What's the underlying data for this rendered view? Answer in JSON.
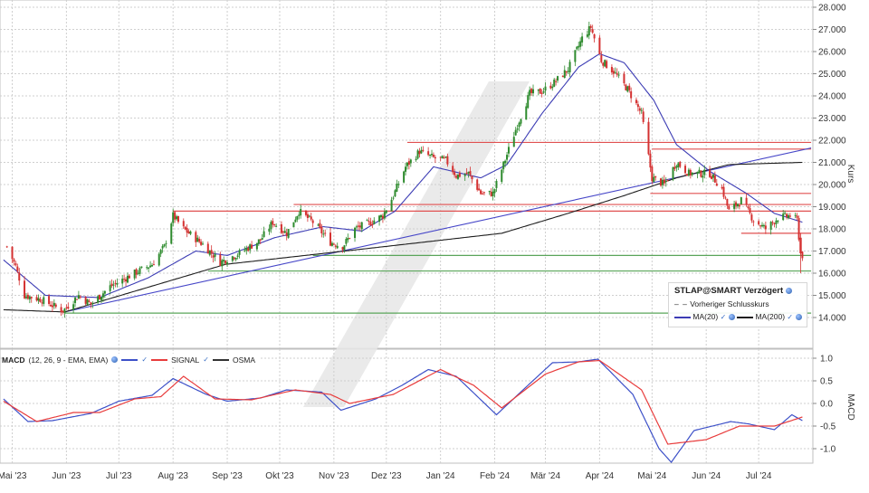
{
  "chart_data": [
    {
      "type": "candlestick",
      "title": "STLAP@SMART Verzögert",
      "ylabel": "Kurs",
      "ylim": [
        13.0,
        28.0
      ],
      "y_ticks": [
        "14.000",
        "15.000",
        "16.000",
        "17.000",
        "18.000",
        "19.000",
        "20.000",
        "21.000",
        "22.000",
        "23.000",
        "24.000",
        "25.000",
        "26.000",
        "27.000",
        "28.000"
      ],
      "x_ticks": [
        "Mai '23",
        "Jun '23",
        "Jul '23",
        "Aug '23",
        "Sep '23",
        "Okt '23",
        "Nov '23",
        "Dez '23",
        "Jan '24",
        "Feb '24",
        "Mär '24",
        "Apr '24",
        "Mai '24",
        "Jun '24",
        "Jul '24"
      ],
      "close_anchors": [
        {
          "date": "2023-04-28",
          "value": 17.2
        },
        {
          "date": "2023-05-03",
          "value": 16.3
        },
        {
          "date": "2023-05-08",
          "value": 15.0
        },
        {
          "date": "2023-05-18",
          "value": 14.8
        },
        {
          "date": "2023-05-30",
          "value": 14.3
        },
        {
          "date": "2023-06-08",
          "value": 15.0
        },
        {
          "date": "2023-06-15",
          "value": 14.6
        },
        {
          "date": "2023-06-26",
          "value": 15.4
        },
        {
          "date": "2023-07-10",
          "value": 16.0
        },
        {
          "date": "2023-07-20",
          "value": 16.4
        },
        {
          "date": "2023-07-27",
          "value": 17.2
        },
        {
          "date": "2023-08-01",
          "value": 18.6
        },
        {
          "date": "2023-08-07",
          "value": 18.0
        },
        {
          "date": "2023-08-18",
          "value": 17.3
        },
        {
          "date": "2023-08-28",
          "value": 16.5
        },
        {
          "date": "2023-09-08",
          "value": 16.9
        },
        {
          "date": "2023-09-20",
          "value": 17.5
        },
        {
          "date": "2023-09-27",
          "value": 18.3
        },
        {
          "date": "2023-10-05",
          "value": 17.8
        },
        {
          "date": "2023-10-12",
          "value": 18.8
        },
        {
          "date": "2023-10-20",
          "value": 18.3
        },
        {
          "date": "2023-10-30",
          "value": 17.4
        },
        {
          "date": "2023-11-06",
          "value": 17.2
        },
        {
          "date": "2023-11-13",
          "value": 18.0
        },
        {
          "date": "2023-11-22",
          "value": 18.3
        },
        {
          "date": "2023-11-29",
          "value": 18.6
        },
        {
          "date": "2023-12-05",
          "value": 19.5
        },
        {
          "date": "2023-12-12",
          "value": 20.8
        },
        {
          "date": "2023-12-20",
          "value": 21.5
        },
        {
          "date": "2023-12-28",
          "value": 21.2
        },
        {
          "date": "2024-01-04",
          "value": 21.1
        },
        {
          "date": "2024-01-10",
          "value": 20.4
        },
        {
          "date": "2024-01-17",
          "value": 20.5
        },
        {
          "date": "2024-01-24",
          "value": 19.6
        },
        {
          "date": "2024-01-31",
          "value": 19.6
        },
        {
          "date": "2024-02-06",
          "value": 20.9
        },
        {
          "date": "2024-02-14",
          "value": 22.7
        },
        {
          "date": "2024-02-21",
          "value": 24.1
        },
        {
          "date": "2024-02-28",
          "value": 24.2
        },
        {
          "date": "2024-03-06",
          "value": 24.6
        },
        {
          "date": "2024-03-14",
          "value": 25.2
        },
        {
          "date": "2024-03-22",
          "value": 26.6
        },
        {
          "date": "2024-03-27",
          "value": 27.1
        },
        {
          "date": "2024-04-02",
          "value": 25.6
        },
        {
          "date": "2024-04-09",
          "value": 25.1
        },
        {
          "date": "2024-04-17",
          "value": 24.3
        },
        {
          "date": "2024-04-25",
          "value": 23.2
        },
        {
          "date": "2024-05-01",
          "value": 20.3
        },
        {
          "date": "2024-05-08",
          "value": 20.0
        },
        {
          "date": "2024-05-15",
          "value": 21.0
        },
        {
          "date": "2024-05-22",
          "value": 20.5
        },
        {
          "date": "2024-06-03",
          "value": 20.5
        },
        {
          "date": "2024-06-10",
          "value": 19.8
        },
        {
          "date": "2024-06-14",
          "value": 18.8
        },
        {
          "date": "2024-06-21",
          "value": 19.3
        },
        {
          "date": "2024-06-28",
          "value": 18.4
        },
        {
          "date": "2024-07-05",
          "value": 18.0
        },
        {
          "date": "2024-07-12",
          "value": 18.5
        },
        {
          "date": "2024-07-19",
          "value": 18.6
        },
        {
          "date": "2024-07-23",
          "value": 18.4
        },
        {
          "date": "2024-07-25",
          "value": 16.9
        },
        {
          "date": "2024-07-26",
          "value": 16.8
        }
      ],
      "indicators": {
        "ma20_anchors": [
          {
            "date": "2023-04-26",
            "value": 16.6
          },
          {
            "date": "2023-05-20",
            "value": 15.0
          },
          {
            "date": "2023-06-20",
            "value": 14.9
          },
          {
            "date": "2023-07-18",
            "value": 15.8
          },
          {
            "date": "2023-08-14",
            "value": 17.0
          },
          {
            "date": "2023-09-01",
            "value": 16.8
          },
          {
            "date": "2023-09-28",
            "value": 17.6
          },
          {
            "date": "2023-10-26",
            "value": 18.1
          },
          {
            "date": "2023-11-17",
            "value": 17.9
          },
          {
            "date": "2023-12-06",
            "value": 18.8
          },
          {
            "date": "2023-12-28",
            "value": 20.8
          },
          {
            "date": "2024-01-24",
            "value": 20.3
          },
          {
            "date": "2024-02-08",
            "value": 20.9
          },
          {
            "date": "2024-02-28",
            "value": 23.2
          },
          {
            "date": "2024-03-20",
            "value": 25.3
          },
          {
            "date": "2024-04-01",
            "value": 25.9
          },
          {
            "date": "2024-04-15",
            "value": 25.5
          },
          {
            "date": "2024-05-02",
            "value": 23.8
          },
          {
            "date": "2024-05-15",
            "value": 21.8
          },
          {
            "date": "2024-06-03",
            "value": 20.6
          },
          {
            "date": "2024-06-24",
            "value": 19.6
          },
          {
            "date": "2024-07-10",
            "value": 18.7
          },
          {
            "date": "2024-07-26",
            "value": 18.3
          }
        ],
        "ma200_anchors": [
          {
            "date": "2023-04-26",
            "value": 14.35
          },
          {
            "date": "2023-05-31",
            "value": 14.25
          },
          {
            "date": "2023-08-31",
            "value": 16.4
          },
          {
            "date": "2023-11-30",
            "value": 17.2
          },
          {
            "date": "2024-02-05",
            "value": 17.8
          },
          {
            "date": "2024-03-14",
            "value": 18.7
          },
          {
            "date": "2024-04-15",
            "value": 19.5
          },
          {
            "date": "2024-05-15",
            "value": 20.3
          },
          {
            "date": "2024-06-14",
            "value": 20.9
          },
          {
            "date": "2024-07-26",
            "value": 21.0
          }
        ],
        "trendline": {
          "from": {
            "date": "2023-05-31",
            "value": 14.25
          },
          "to": {
            "date": "2024-07-31",
            "value": 21.65
          }
        }
      },
      "hlines": [
        {
          "value": 21.9,
          "from": "2023-12-13",
          "to": "2024-07-31",
          "color": "#e05050"
        },
        {
          "value": 21.6,
          "from": "2024-05-01",
          "to": "2024-07-31",
          "color": "#e05050"
        },
        {
          "value": 19.6,
          "from": "2024-04-30",
          "to": "2024-07-31",
          "color": "#e05050"
        },
        {
          "value": 19.1,
          "from": "2023-10-09",
          "to": "2024-07-31",
          "color": "#e05050"
        },
        {
          "value": 18.8,
          "from": "2023-08-01",
          "to": "2024-07-31",
          "color": "#e05050"
        },
        {
          "value": 17.8,
          "from": "2024-06-21",
          "to": "2024-07-31",
          "color": "#e05050"
        },
        {
          "value": 16.8,
          "from": "2023-10-20",
          "to": "2024-07-31",
          "color": "#5aa55a"
        },
        {
          "value": 16.1,
          "from": "2023-08-21",
          "to": "2024-07-31",
          "color": "#5aa55a"
        },
        {
          "value": 14.2,
          "from": "2023-05-31",
          "to": "2024-07-31",
          "color": "#5aa55a"
        }
      ]
    },
    {
      "type": "line",
      "ylabel": "MACD",
      "ylim": [
        -1.35,
        1.15
      ],
      "y_ticks": [
        "1.0",
        "0.5",
        "0.0",
        "-0.5",
        "-1.0"
      ],
      "series": [
        {
          "name": "MACD",
          "anchors": [
            {
              "date": "2023-04-26",
              "value": 0.1
            },
            {
              "date": "2023-05-10",
              "value": -0.4
            },
            {
              "date": "2023-05-24",
              "value": -0.38
            },
            {
              "date": "2023-06-15",
              "value": -0.22
            },
            {
              "date": "2023-07-01",
              "value": 0.05
            },
            {
              "date": "2023-07-20",
              "value": 0.18
            },
            {
              "date": "2023-08-01",
              "value": 0.55
            },
            {
              "date": "2023-08-20",
              "value": 0.2
            },
            {
              "date": "2023-09-01",
              "value": 0.05
            },
            {
              "date": "2023-09-20",
              "value": 0.12
            },
            {
              "date": "2023-10-05",
              "value": 0.3
            },
            {
              "date": "2023-10-25",
              "value": 0.25
            },
            {
              "date": "2023-11-05",
              "value": -0.15
            },
            {
              "date": "2023-11-25",
              "value": 0.1
            },
            {
              "date": "2023-12-10",
              "value": 0.4
            },
            {
              "date": "2023-12-25",
              "value": 0.75
            },
            {
              "date": "2024-01-10",
              "value": 0.6
            },
            {
              "date": "2024-02-02",
              "value": -0.25
            },
            {
              "date": "2024-02-20",
              "value": 0.4
            },
            {
              "date": "2024-03-05",
              "value": 0.9
            },
            {
              "date": "2024-03-20",
              "value": 0.92
            },
            {
              "date": "2024-03-31",
              "value": 0.98
            },
            {
              "date": "2024-04-20",
              "value": 0.2
            },
            {
              "date": "2024-05-05",
              "value": -1.0
            },
            {
              "date": "2024-05-12",
              "value": -1.3
            },
            {
              "date": "2024-05-25",
              "value": -0.6
            },
            {
              "date": "2024-06-15",
              "value": -0.4
            },
            {
              "date": "2024-06-25",
              "value": -0.45
            },
            {
              "date": "2024-07-10",
              "value": -0.58
            },
            {
              "date": "2024-07-20",
              "value": -0.25
            },
            {
              "date": "2024-07-26",
              "value": -0.38
            }
          ]
        },
        {
          "name": "SIGNAL",
          "anchors": [
            {
              "date": "2023-04-26",
              "value": 0.05
            },
            {
              "date": "2023-05-15",
              "value": -0.4
            },
            {
              "date": "2023-06-05",
              "value": -0.2
            },
            {
              "date": "2023-06-20",
              "value": -0.2
            },
            {
              "date": "2023-07-10",
              "value": 0.1
            },
            {
              "date": "2023-07-25",
              "value": 0.15
            },
            {
              "date": "2023-08-07",
              "value": 0.6
            },
            {
              "date": "2023-08-25",
              "value": 0.1
            },
            {
              "date": "2023-09-15",
              "value": 0.08
            },
            {
              "date": "2023-10-10",
              "value": 0.3
            },
            {
              "date": "2023-10-30",
              "value": 0.2
            },
            {
              "date": "2023-11-10",
              "value": 0.0
            },
            {
              "date": "2023-12-05",
              "value": 0.2
            },
            {
              "date": "2024-01-01",
              "value": 0.75
            },
            {
              "date": "2024-01-20",
              "value": 0.4
            },
            {
              "date": "2024-02-05",
              "value": -0.1
            },
            {
              "date": "2024-03-01",
              "value": 0.65
            },
            {
              "date": "2024-03-20",
              "value": 0.92
            },
            {
              "date": "2024-04-01",
              "value": 0.95
            },
            {
              "date": "2024-04-25",
              "value": 0.3
            },
            {
              "date": "2024-05-10",
              "value": -0.9
            },
            {
              "date": "2024-06-01",
              "value": -0.8
            },
            {
              "date": "2024-06-20",
              "value": -0.5
            },
            {
              "date": "2024-07-10",
              "value": -0.5
            },
            {
              "date": "2024-07-26",
              "value": -0.3
            }
          ]
        }
      ],
      "legend": {
        "macd_params": "(12, 26, 9 - EMA, EMA)",
        "items": [
          "MACD",
          "SIGNAL",
          "OSMA"
        ]
      }
    }
  ],
  "legend": {
    "title": "STLAP@SMART Verzögert",
    "prev_close": "Vorheriger Schlusskurs",
    "ma20": "MA(20)",
    "ma200": "MA(200)"
  },
  "colors": {
    "up": "#2e8b2e",
    "down": "#d43131",
    "ma20": "#3c3cb4",
    "ma200": "#1e1e1e",
    "trend": "#4646c8",
    "signal": "#e83c3c",
    "macd": "#3c50c8"
  }
}
